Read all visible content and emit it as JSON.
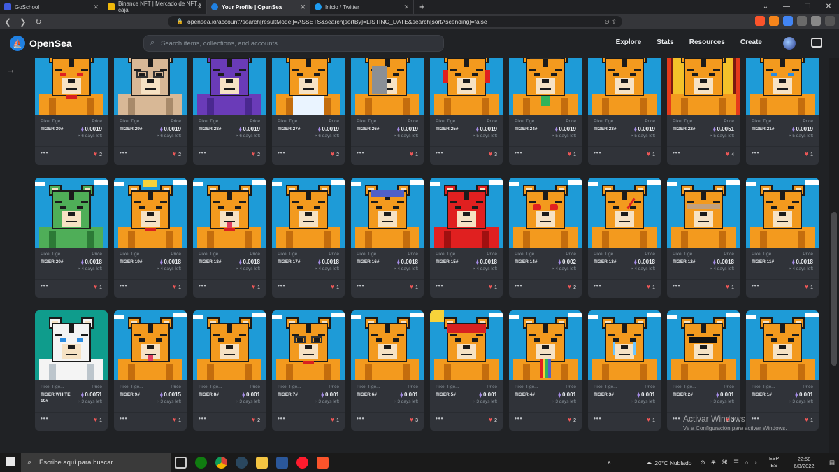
{
  "browser": {
    "tabs": [
      {
        "label": "GoSchool",
        "fav_color": "#3f5be0"
      },
      {
        "label": "Binance NFT | Mercado de NFT y caja",
        "fav_color": "#f0b90b"
      },
      {
        "label": "Your Profile | OpenSea",
        "fav_color": "#2081e2"
      },
      {
        "label": "Inicio / Twitter",
        "fav_color": "#1d9bf0"
      }
    ],
    "url": "opensea.io/account?search[resultModel]=ASSETS&search[sortBy]=LISTING_DATE&search[sortAscending]=false"
  },
  "header": {
    "brand": "OpenSea",
    "search_placeholder": "Search items, collections, and accounts",
    "nav": [
      "Explore",
      "Stats",
      "Resources",
      "Create"
    ]
  },
  "grid": {
    "collection": "Pixel Tige...",
    "price_label": "Price",
    "items": [
      {
        "name": "TIGER 30#",
        "price": "0.0019",
        "days": "6 days left",
        "likes": "2",
        "variant": "red-eyes"
      },
      {
        "name": "TIGER 29#",
        "price": "0.0019",
        "days": "6 days left",
        "likes": "2",
        "variant": "grey-glasses"
      },
      {
        "name": "TIGER 28#",
        "price": "0.0019",
        "days": "6 days left",
        "likes": "2",
        "variant": "purple"
      },
      {
        "name": "TIGER 27#",
        "price": "0.0019",
        "days": "6 days left",
        "likes": "2",
        "variant": "white-shirt"
      },
      {
        "name": "TIGER 26#",
        "price": "0.0019",
        "days": "6 days left",
        "likes": "1",
        "variant": "robot"
      },
      {
        "name": "TIGER 25#",
        "price": "0.0019",
        "days": "5 days left",
        "likes": "3",
        "variant": "headphones"
      },
      {
        "name": "TIGER 24#",
        "price": "0.0019",
        "days": "5 days left",
        "likes": "1",
        "variant": "tophat"
      },
      {
        "name": "TIGER 23#",
        "price": "0.0019",
        "days": "5 days left",
        "likes": "1",
        "variant": "plain"
      },
      {
        "name": "TIGER 22#",
        "price": "0.0051",
        "days": "5 days left",
        "likes": "4",
        "variant": "red-frame"
      },
      {
        "name": "TIGER 21#",
        "price": "0.0019",
        "days": "5 days left",
        "likes": "1",
        "variant": "blue-eyes"
      },
      {
        "name": "TIGER 20#",
        "price": "0.0018",
        "days": "4 days left",
        "likes": "1",
        "variant": "green"
      },
      {
        "name": "TIGER 19#",
        "price": "0.0018",
        "days": "4 days left",
        "likes": "1",
        "variant": "crown"
      },
      {
        "name": "TIGER 18#",
        "price": "0.0018",
        "days": "4 days left",
        "likes": "1",
        "variant": "tongue"
      },
      {
        "name": "TIGER 17#",
        "price": "0.0018",
        "days": "4 days left",
        "likes": "1",
        "variant": "plain"
      },
      {
        "name": "TIGER 16#",
        "price": "0.0018",
        "days": "4 days left",
        "likes": "1",
        "variant": "cap"
      },
      {
        "name": "TIGER 15#",
        "price": "0.0018",
        "days": "4 days left",
        "likes": "1",
        "variant": "red-face"
      },
      {
        "name": "TIGER 14#",
        "price": "0.002",
        "days": "4 days left",
        "likes": "2",
        "variant": "heart-eyes"
      },
      {
        "name": "TIGER 13#",
        "price": "0.0018",
        "days": "4 days left",
        "likes": "1",
        "variant": "scar"
      },
      {
        "name": "TIGER 12#",
        "price": "0.0018",
        "days": "4 days left",
        "likes": "1",
        "variant": "visor"
      },
      {
        "name": "TIGER 11#",
        "price": "0.0018",
        "days": "4 days left",
        "likes": "1",
        "variant": "plain"
      },
      {
        "name": "TIGER WHITE 10#",
        "price": "0.0051",
        "days": "3 days left",
        "likes": "1",
        "variant": "white"
      },
      {
        "name": "TIGER 9#",
        "price": "0.0015",
        "days": "3 days left",
        "likes": "1",
        "variant": "drool"
      },
      {
        "name": "TIGER 8#",
        "price": "0.001",
        "days": "3 days left",
        "likes": "2",
        "variant": "plain"
      },
      {
        "name": "TIGER 7#",
        "price": "0.001",
        "days": "3 days left",
        "likes": "1",
        "variant": "glasses"
      },
      {
        "name": "TIGER 6#",
        "price": "0.001",
        "days": "3 days left",
        "likes": "3",
        "variant": "sleepy"
      },
      {
        "name": "TIGER 5#",
        "price": "0.001",
        "days": "3 days left",
        "likes": "2",
        "variant": "pirate"
      },
      {
        "name": "TIGER 4#",
        "price": "0.001",
        "days": "3 days left",
        "likes": "2",
        "variant": "rainbow"
      },
      {
        "name": "TIGER 3#",
        "price": "0.001",
        "days": "3 days left",
        "likes": "1",
        "variant": "crying"
      },
      {
        "name": "TIGER 2#",
        "price": "0.001",
        "days": "3 days left",
        "likes": "3",
        "variant": "sunglasses"
      },
      {
        "name": "TIGER 1#",
        "price": "0.001",
        "days": "3 days left",
        "likes": "1",
        "variant": "plain"
      }
    ]
  },
  "watermark": {
    "title": "Activar Windows",
    "subtitle": "Ve a Configuración para activar Windows."
  },
  "taskbar": {
    "search_placeholder": "Escribe aquí para buscar",
    "weather": "20°C  Nublado",
    "lang_top": "ESP",
    "lang_bottom": "ES",
    "time": "22:58",
    "date": "6/3/2022"
  }
}
